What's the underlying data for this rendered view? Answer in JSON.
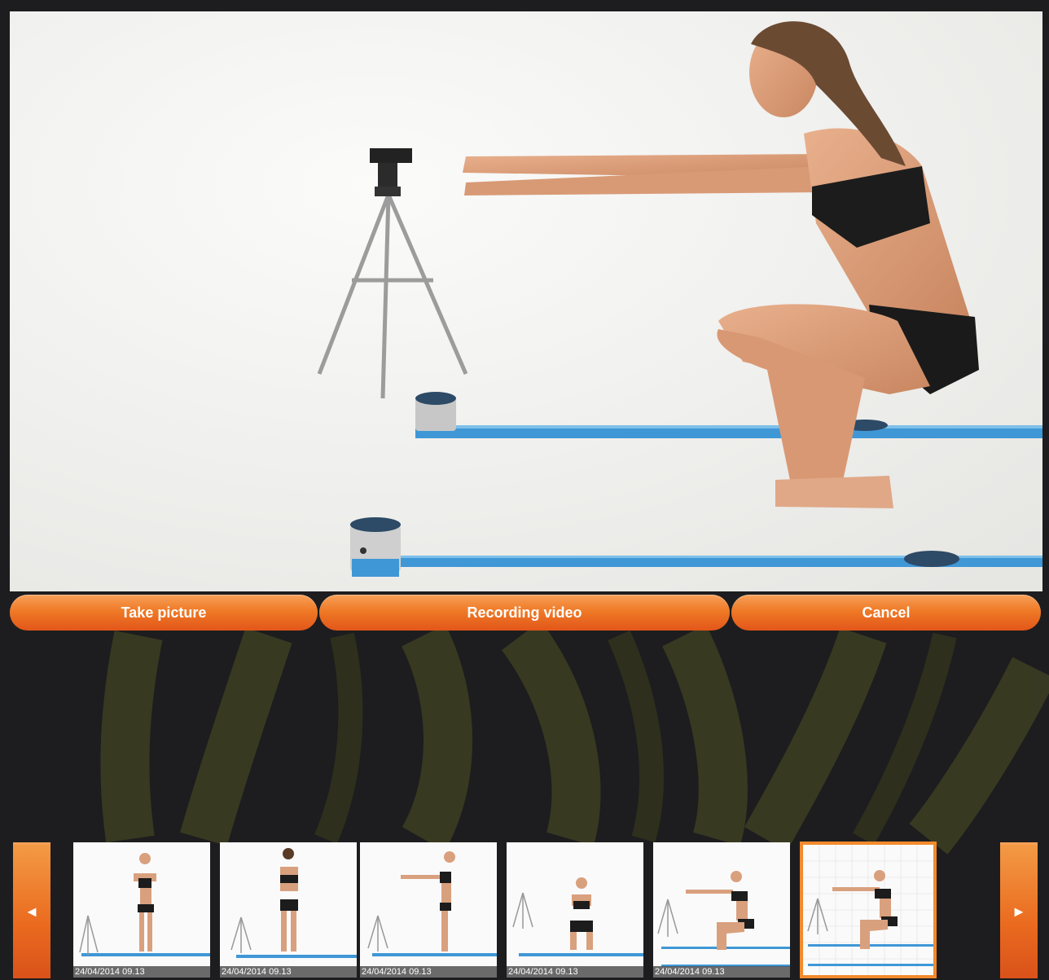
{
  "actions": {
    "take_picture": "Take picture",
    "recording_video": "Recording video",
    "cancel": "Cancel"
  },
  "navigation": {
    "prev_icon": "triangle-left-icon",
    "prev_glyph": "◄",
    "next_icon": "triangle-right-icon",
    "next_glyph": "►"
  },
  "thumbnails": [
    {
      "timestamp": "24/04/2014 09.13",
      "pose": "front-standing"
    },
    {
      "timestamp": "24/04/2014 09.13",
      "pose": "back-standing"
    },
    {
      "timestamp": "24/04/2014 09.13",
      "pose": "side-standing-arms-forward"
    },
    {
      "timestamp": "24/04/2014 09.13",
      "pose": "front-squat"
    },
    {
      "timestamp": "24/04/2014 09.13",
      "pose": "side-squat"
    },
    {
      "timestamp": "",
      "pose": "side-squat-selected",
      "selected": true
    }
  ],
  "colors": {
    "accent": "#ef7a26",
    "background": "#1d1d1f",
    "selection_border": "#f28a2c"
  }
}
